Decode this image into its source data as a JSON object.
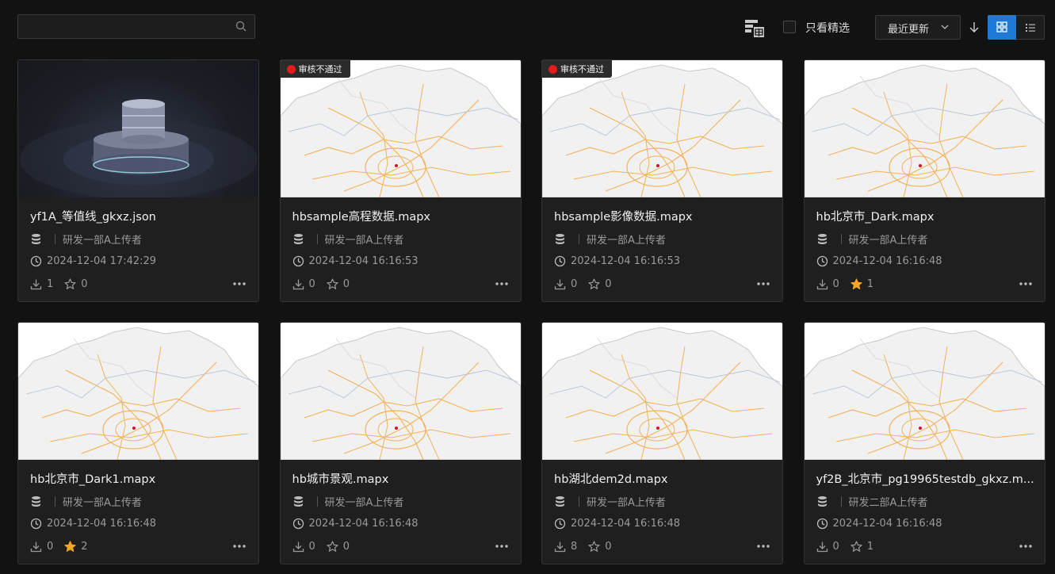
{
  "toolbar": {
    "search_placeholder": "",
    "featured_only_label": "只看精选",
    "sort_label": "最近更新",
    "apply_icon": "apply-icon",
    "accent_color": "#1e7ad6"
  },
  "cards": [
    {
      "title": "yf1A_等值线_gkxz.json",
      "owner": "研发一部A上传者",
      "date": "2024-12-04 17:42:29",
      "downloads": "1",
      "stars": "0",
      "starred": false,
      "badge": "",
      "thumb": "db"
    },
    {
      "title": "hbsample高程数据.mapx",
      "owner": "研发一部A上传者",
      "date": "2024-12-04 16:16:53",
      "downloads": "0",
      "stars": "0",
      "starred": false,
      "badge": "审核不通过",
      "thumb": "map"
    },
    {
      "title": "hbsample影像数据.mapx",
      "owner": "研发一部A上传者",
      "date": "2024-12-04 16:16:53",
      "downloads": "0",
      "stars": "0",
      "starred": false,
      "badge": "审核不通过",
      "thumb": "map"
    },
    {
      "title": "hb北京市_Dark.mapx",
      "owner": "研发一部A上传者",
      "date": "2024-12-04 16:16:48",
      "downloads": "0",
      "stars": "1",
      "starred": true,
      "badge": "",
      "thumb": "map"
    },
    {
      "title": "hb北京市_Dark1.mapx",
      "owner": "研发一部A上传者",
      "date": "2024-12-04 16:16:48",
      "downloads": "0",
      "stars": "2",
      "starred": true,
      "badge": "",
      "thumb": "map"
    },
    {
      "title": "hb城市景观.mapx",
      "owner": "研发一部A上传者",
      "date": "2024-12-04 16:16:48",
      "downloads": "0",
      "stars": "0",
      "starred": false,
      "badge": "",
      "thumb": "map"
    },
    {
      "title": "hb湖北dem2d.mapx",
      "owner": "研发一部A上传者",
      "date": "2024-12-04 16:16:48",
      "downloads": "8",
      "stars": "0",
      "starred": false,
      "badge": "",
      "thumb": "map"
    },
    {
      "title": "yf2B_北京市_pg19965testdb_gkxz.m...",
      "owner": "研发二部A上传者",
      "date": "2024-12-04 16:16:48",
      "downloads": "0",
      "stars": "1",
      "starred": false,
      "badge": "",
      "thumb": "map"
    }
  ]
}
